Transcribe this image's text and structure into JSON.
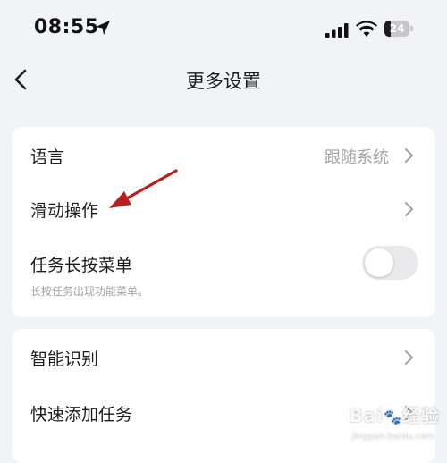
{
  "status_bar": {
    "time": "08:55",
    "battery_level": "24",
    "icons": [
      "location-arrow-icon",
      "cellular-signal-icon",
      "wifi-icon",
      "battery-icon"
    ]
  },
  "nav": {
    "title": "更多设置",
    "back_icon": "chevron-left-icon"
  },
  "settings": {
    "language": {
      "label": "语言",
      "value": "跟随系统"
    },
    "swipe": {
      "label": "滑动操作"
    },
    "long_press": {
      "label": "任务长按菜单",
      "description": "长按任务出现功能菜单。",
      "enabled": false
    },
    "smart_recognition": {
      "label": "智能识别"
    },
    "quick_add": {
      "label": "快速添加任务"
    }
  },
  "annotation": {
    "arrow_color": "#b8201f"
  },
  "watermark": {
    "text": "Baidu经验",
    "sub": "jingyan.baidu.com"
  },
  "colors": {
    "background": "#f2f3f7",
    "card": "#ffffff",
    "secondary_text": "#a1a1a6"
  }
}
